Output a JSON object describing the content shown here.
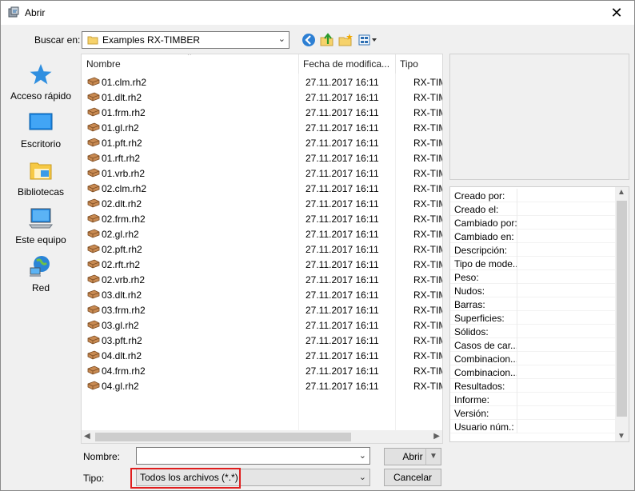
{
  "window": {
    "title": "Abrir",
    "close_glyph": "✕"
  },
  "toolbar": {
    "look_in_label": "Buscar en:",
    "look_in_value": "Examples RX-TIMBER",
    "icons": [
      "back-icon",
      "up-folder-icon",
      "new-folder-icon",
      "view-menu-icon"
    ]
  },
  "places": [
    {
      "label": "Acceso rápido",
      "icon": "quick-access-star-icon"
    },
    {
      "label": "Escritorio",
      "icon": "desktop-icon"
    },
    {
      "label": "Bibliotecas",
      "icon": "libraries-icon"
    },
    {
      "label": "Este equipo",
      "icon": "this-pc-icon"
    },
    {
      "label": "Red",
      "icon": "network-icon"
    }
  ],
  "file_list": {
    "columns": {
      "name": "Nombre",
      "date": "Fecha de modifica...",
      "type": "Tipo"
    },
    "files": [
      {
        "name": "01.clm.rh2",
        "date": "27.11.2017 16:11",
        "type": "RX-TIM"
      },
      {
        "name": "01.dlt.rh2",
        "date": "27.11.2017 16:11",
        "type": "RX-TIM"
      },
      {
        "name": "01.frm.rh2",
        "date": "27.11.2017 16:11",
        "type": "RX-TIM"
      },
      {
        "name": "01.gl.rh2",
        "date": "27.11.2017 16:11",
        "type": "RX-TIM"
      },
      {
        "name": "01.pft.rh2",
        "date": "27.11.2017 16:11",
        "type": "RX-TIM"
      },
      {
        "name": "01.rft.rh2",
        "date": "27.11.2017 16:11",
        "type": "RX-TIM"
      },
      {
        "name": "01.vrb.rh2",
        "date": "27.11.2017 16:11",
        "type": "RX-TIM"
      },
      {
        "name": "02.clm.rh2",
        "date": "27.11.2017 16:11",
        "type": "RX-TIM"
      },
      {
        "name": "02.dlt.rh2",
        "date": "27.11.2017 16:11",
        "type": "RX-TIM"
      },
      {
        "name": "02.frm.rh2",
        "date": "27.11.2017 16:11",
        "type": "RX-TIM"
      },
      {
        "name": "02.gl.rh2",
        "date": "27.11.2017 16:11",
        "type": "RX-TIM"
      },
      {
        "name": "02.pft.rh2",
        "date": "27.11.2017 16:11",
        "type": "RX-TIM"
      },
      {
        "name": "02.rft.rh2",
        "date": "27.11.2017 16:11",
        "type": "RX-TIM"
      },
      {
        "name": "02.vrb.rh2",
        "date": "27.11.2017 16:11",
        "type": "RX-TIM"
      },
      {
        "name": "03.dlt.rh2",
        "date": "27.11.2017 16:11",
        "type": "RX-TIM"
      },
      {
        "name": "03.frm.rh2",
        "date": "27.11.2017 16:11",
        "type": "RX-TIM"
      },
      {
        "name": "03.gl.rh2",
        "date": "27.11.2017 16:11",
        "type": "RX-TIM"
      },
      {
        "name": "03.pft.rh2",
        "date": "27.11.2017 16:11",
        "type": "RX-TIM"
      },
      {
        "name": "04.dlt.rh2",
        "date": "27.11.2017 16:11",
        "type": "RX-TIM"
      },
      {
        "name": "04.frm.rh2",
        "date": "27.11.2017 16:11",
        "type": "RX-TIM"
      },
      {
        "name": "04.gl.rh2",
        "date": "27.11.2017 16:11",
        "type": "RX-TIM"
      }
    ]
  },
  "properties": [
    "Creado por:",
    "Creado el:",
    "Cambiado por:",
    "Cambiado en:",
    "Descripción:",
    "Tipo de mode...",
    "Peso:",
    "Nudos:",
    "Barras:",
    "Superficies:",
    "Sólidos:",
    "Casos de car...",
    "Combinacion...",
    "Combinacion...",
    "Resultados:",
    "Informe:",
    "Versión:",
    "Usuario núm.:"
  ],
  "footer": {
    "filename_label": "Nombre:",
    "filename_value": "",
    "filetype_label": "Tipo:",
    "filetype_value": "Todos los archivos (*.*)",
    "open_button": "Abrir",
    "cancel_button": "Cancelar"
  },
  "colors": {
    "highlight": "#e01e1e",
    "accent": "#0078d7"
  }
}
